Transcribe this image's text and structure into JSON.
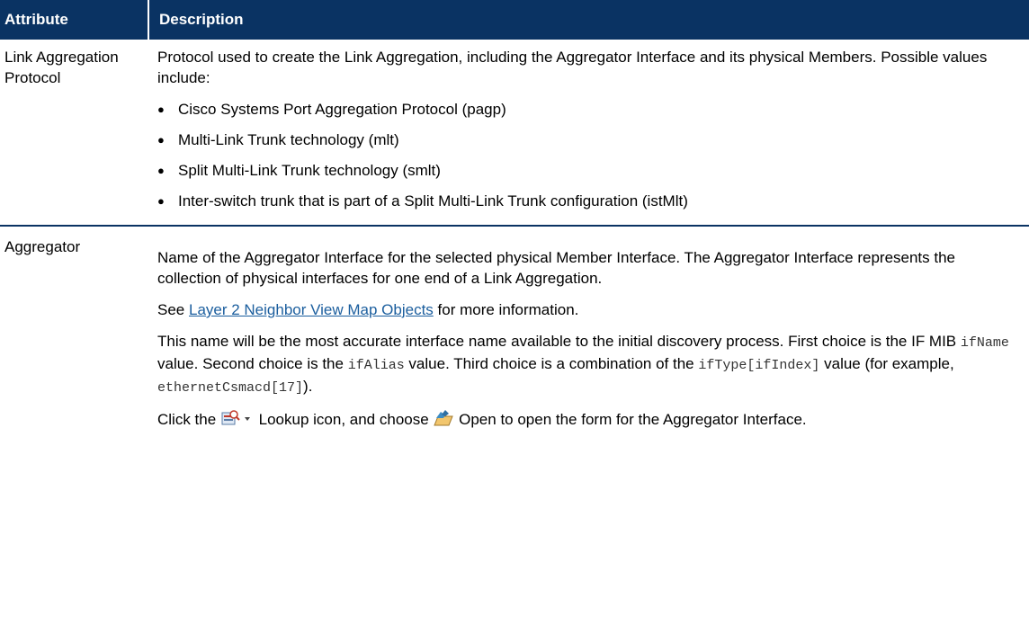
{
  "table": {
    "headers": {
      "attribute": "Attribute",
      "description": "Description"
    },
    "row1": {
      "name": "Link Aggregation Protocol",
      "intro": "Protocol used to create the Link Aggregation, including the Aggregator Interface and its physical Members. Possible values include:",
      "values": [
        "Cisco Systems Port Aggregation Protocol (pagp)",
        "Multi-Link Trunk technology (mlt)",
        "Split Multi-Link Trunk technology (smlt)",
        "Inter-switch trunk that is part of a Split Multi-Link Trunk configuration (istMlt)"
      ]
    },
    "row2": {
      "name": "Aggregator",
      "p1": "Name of the Aggregator Interface for the selected physical Member Interface. The Aggregator Interface represents the collection of physical interfaces for one end of a Link Aggregation.",
      "see_prefix": "See ",
      "see_link": "Layer 2 Neighbor View Map Objects",
      "see_suffix": " for more information.",
      "p3_a": "This name will be the most accurate interface name available to the initial discovery process. First choice is the IF MIB ",
      "p3_code1": "ifName",
      "p3_b": " value. Second choice is the ",
      "p3_code2": "ifAlias",
      "p3_c": " value. Third choice is a combination of the ",
      "p3_code3": "ifType[ifIndex]",
      "p3_d": " value (for example, ",
      "p3_code4": "ethernetCsmacd[17]",
      "p3_e": ").",
      "p4_a": "Click the ",
      "p4_b": " Lookup icon, and choose ",
      "p4_c": " Open to open the form for the Aggregator Interface."
    }
  },
  "icons": {
    "lookup": "lookup-icon",
    "dropdown": "dropdown-arrow-icon",
    "open": "open-form-icon"
  }
}
